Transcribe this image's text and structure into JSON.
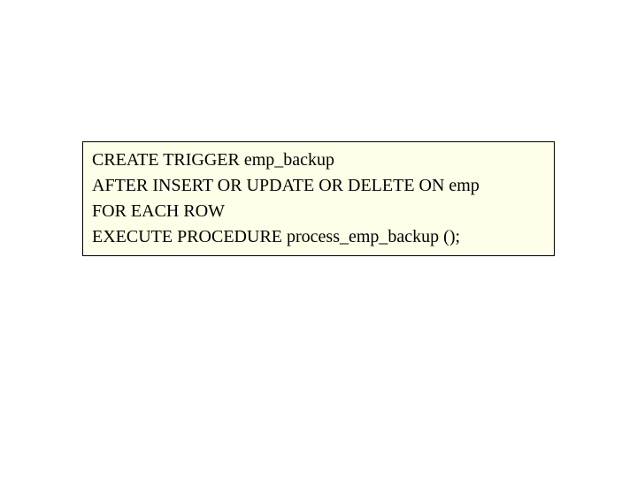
{
  "code": {
    "line1": "CREATE TRIGGER emp_backup",
    "line2": "AFTER INSERT OR UPDATE OR DELETE ON emp",
    "line3": "FOR EACH ROW",
    "line4": "EXECUTE PROCEDURE process_emp_backup ();"
  }
}
